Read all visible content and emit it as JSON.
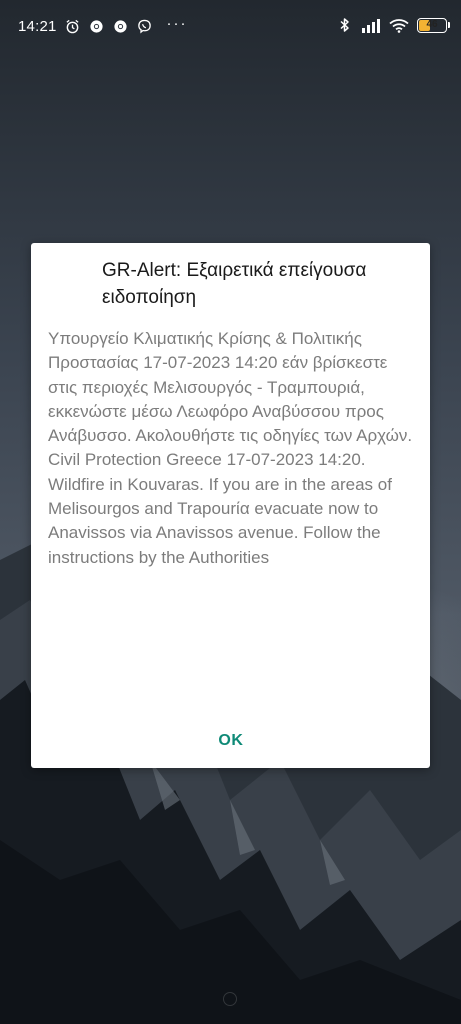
{
  "status_bar": {
    "time": "14:21",
    "left_icons": [
      "alarm-clock-icon",
      "chrome-icon",
      "chrome-icon",
      "viber-icon"
    ],
    "overflow": "···",
    "right_icons": [
      "bluetooth-icon",
      "signal-icon",
      "wifi-icon"
    ],
    "battery_level": "46",
    "battery_fill_percent": 46,
    "battery_color": "#f2b233"
  },
  "dialog": {
    "title": "GR-Alert: Εξαιρετικά επείγουσα ειδοποίηση",
    "message": "Υπουργείο Κλιματικής Κρίσης & Πολιτικής Προστασίας 17-07-2023 14:20 εάν βρίσκεστε στις  περιοχές Μελισουργός  - Τραμπουριά, εκκενώστε μέσω Λεωφόρο Αναβύσσου προς Ανάβυσσο. Ακολουθήστε τις οδηγίες των Αρχών.\nCivil Protection Greece 17-07-2023 14:20. Wildfire in Kouvaras. If you are in the  areas of Melisourgos and Trapourία  evacuate now to Anavissos  via Anavissos avenue. Follow the instructions by the Authorities",
    "ok_label": "OK",
    "accent_color": "#0f8a77"
  }
}
